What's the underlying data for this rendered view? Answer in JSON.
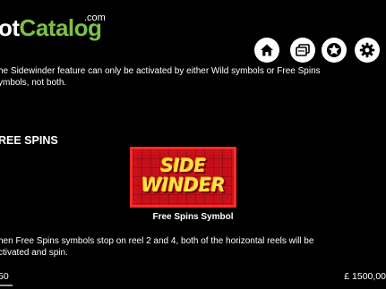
{
  "logo": {
    "slot": "ot",
    "catalog": "Catalog",
    "com": ".com"
  },
  "header_icons": [
    {
      "name": "home-icon"
    },
    {
      "name": "paytable-icon"
    },
    {
      "name": "star-icon"
    },
    {
      "name": "settings-icon"
    }
  ],
  "intro": {
    "line1": "he Sidewinder feature can only be activated by either Wild symbols or Free Spins",
    "line2": "ymbols, not both."
  },
  "free_spins": {
    "heading": "REE SPINS",
    "symbol_text_1": "SIDE",
    "symbol_text_2": "WINDER",
    "caption": "Free Spins Symbol",
    "desc1": "hen Free Spins symbols stop on reel 2 and 4, both of the horizontal reels will be",
    "desc2": "ctivated and spin."
  },
  "footer": {
    "bet": "50",
    "balance": "£ 1500,00"
  },
  "colors": {
    "accent": "#7dc142",
    "symbol_bg": "#c4101a",
    "symbol_text": "#ffe14a"
  }
}
